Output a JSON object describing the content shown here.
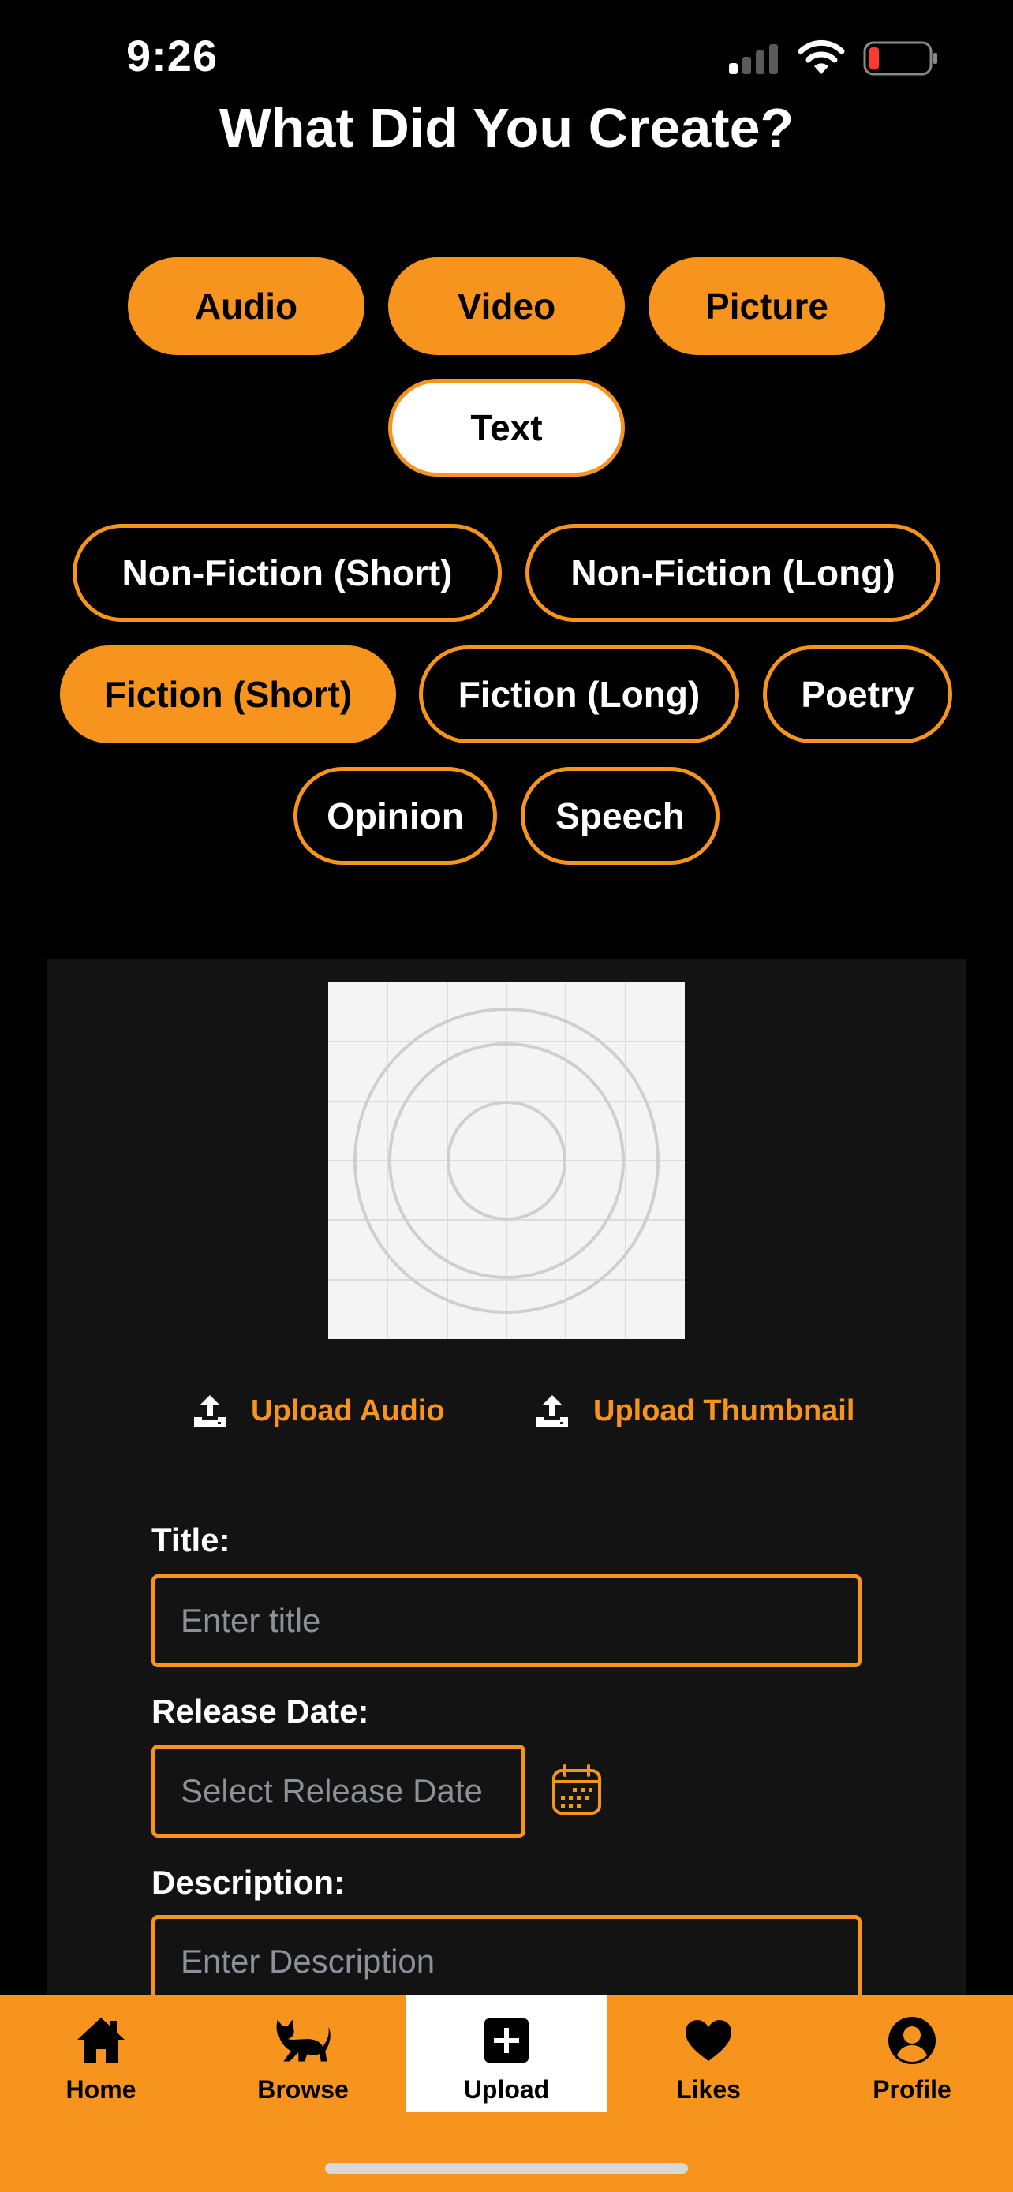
{
  "status_bar": {
    "time": "9:26"
  },
  "page_title": "What Did You Create?",
  "media_types": [
    {
      "label": "Audio",
      "selected": false
    },
    {
      "label": "Video",
      "selected": false
    },
    {
      "label": "Picture",
      "selected": false
    },
    {
      "label": "Text",
      "selected": true
    }
  ],
  "genres": [
    {
      "label": "Non-Fiction (Short)",
      "selected": false
    },
    {
      "label": "Non-Fiction (Long)",
      "selected": false
    },
    {
      "label": "Fiction (Short)",
      "selected": true
    },
    {
      "label": "Fiction (Long)",
      "selected": false
    },
    {
      "label": "Poetry",
      "selected": false
    },
    {
      "label": "Opinion",
      "selected": false
    },
    {
      "label": "Speech",
      "selected": false
    }
  ],
  "upload": {
    "audio_label": "Upload Audio",
    "thumbnail_label": "Upload Thumbnail"
  },
  "form": {
    "title_label": "Title:",
    "title_placeholder": "Enter title",
    "release_label": "Release Date:",
    "release_placeholder": "Select Release Date",
    "description_label": "Description:",
    "description_placeholder": "Enter Description"
  },
  "tabs": [
    {
      "label": "Home",
      "icon": "home-icon"
    },
    {
      "label": "Browse",
      "icon": "cat-icon"
    },
    {
      "label": "Upload",
      "icon": "plus-square-icon",
      "active": true
    },
    {
      "label": "Likes",
      "icon": "heart-icon"
    },
    {
      "label": "Profile",
      "icon": "user-circle-icon"
    }
  ],
  "colors": {
    "accent": "#f7941d",
    "background": "#000000",
    "panel": "#131313",
    "placeholder": "#8c9199",
    "battery_low": "#ff3b30"
  }
}
